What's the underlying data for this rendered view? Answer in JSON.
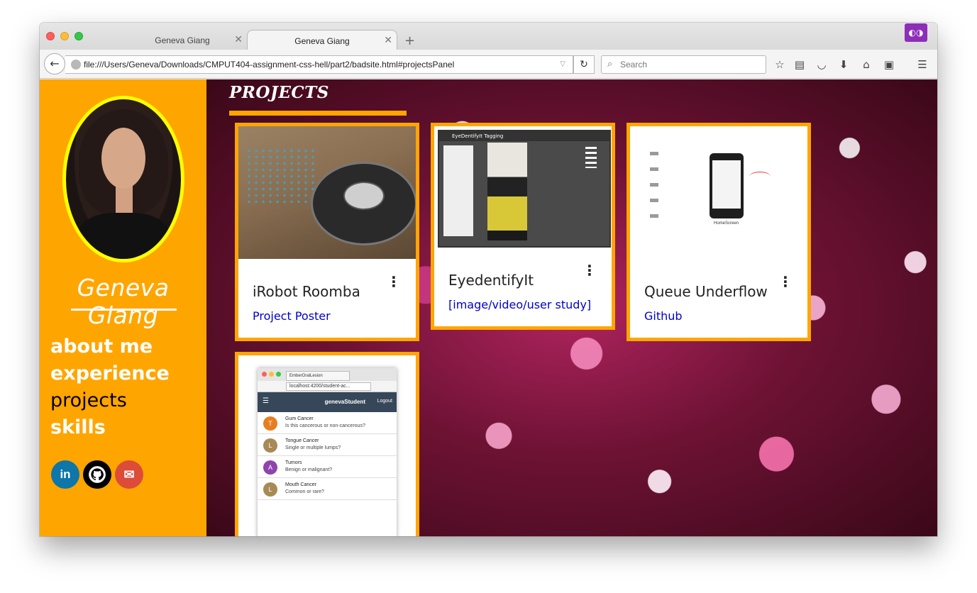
{
  "browser": {
    "tabs": [
      {
        "label": "Geneva Giang",
        "active": false
      },
      {
        "label": "Geneva Giang",
        "active": true
      }
    ],
    "new_tab_label": "+",
    "url": "file:///Users/Geneva/Downloads/CMPUT404-assignment-css-hell/part2/badsite.html#projectsPanel",
    "search_placeholder": "Search",
    "icons": [
      "back-icon",
      "globe-icon",
      "dropdown-icon",
      "reload-icon",
      "search-icon",
      "bookmark-star-icon",
      "reader-icon",
      "pocket-icon",
      "download-icon",
      "home-icon",
      "screenshot-icon",
      "menu-icon",
      "private-mask-icon"
    ]
  },
  "sidebar": {
    "name": "Geneva Giang",
    "nav": [
      {
        "label": "about me",
        "active": false
      },
      {
        "label": "experience",
        "active": false
      },
      {
        "label": "projects",
        "active": true
      },
      {
        "label": "skills",
        "active": false
      }
    ],
    "social": [
      {
        "label": "in",
        "icon": "linkedin-icon"
      },
      {
        "label": "",
        "icon": "github-icon"
      },
      {
        "label": "",
        "icon": "email-icon"
      }
    ]
  },
  "projects": {
    "title": "PROJECTS",
    "cards": [
      {
        "title": "iRobot Roomba",
        "link": "Project Poster"
      },
      {
        "title": "EyedentifyIt",
        "link": "[image/video/user study]"
      },
      {
        "title": "Queue Underflow",
        "link": "Github"
      }
    ],
    "eyedentify_window_title": "EyeDentifyIt Tagging",
    "queue_phone_label": "HomeScreen",
    "ember": {
      "tab_title": "EmberOralLesion",
      "url": "localhost:4200/student-ac...",
      "brand": "genevaStudent",
      "logout": "Logout",
      "rows": [
        {
          "initial": "T",
          "title": "Gum Cancer",
          "subtitle": "Is this cancerous or non-cancerous?",
          "color": "#e67e22"
        },
        {
          "initial": "L",
          "title": "Tongue Cancer",
          "subtitle": "Single or multiple lumps?",
          "color": "#a88a55"
        },
        {
          "initial": "A",
          "title": "Tumors",
          "subtitle": "Benign or malignant?",
          "color": "#8e44ad"
        },
        {
          "initial": "L",
          "title": "Mouth Cancer",
          "subtitle": "Common or rare?",
          "color": "#a88a55"
        }
      ]
    }
  },
  "colors": {
    "sidebar": "#ffa500",
    "avatar_border": "#ffff00",
    "link": "#0000cc",
    "card_border": "#ffa500"
  }
}
